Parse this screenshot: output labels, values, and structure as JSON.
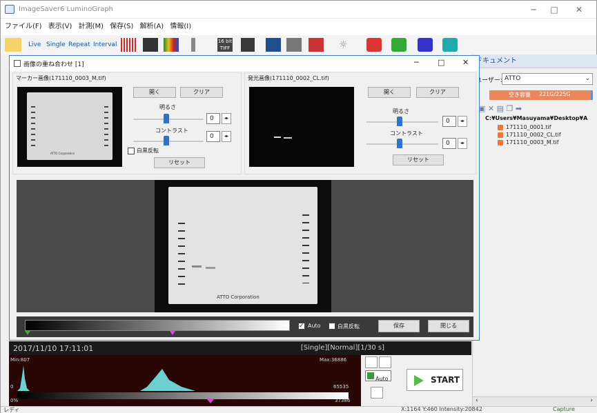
{
  "app": {
    "title": "ImageSaver6 LuminoGraph",
    "win_min": "─",
    "win_max": "□",
    "win_close": "✕"
  },
  "menu": [
    "ファイル(F)",
    "表示(V)",
    "計測(M)",
    "保存(S)",
    "解析(A)",
    "情報(I)"
  ],
  "toolbar": {
    "live": "Live",
    "single": "Single",
    "repeat": "Repeat",
    "interval": "Interval",
    "bit_label": "16 bit TIFF"
  },
  "right_panel": {
    "header": "ドキュメント",
    "user_label": "ユーザー:",
    "user_value": "ATTO",
    "capacity_label": "空き容量",
    "capacity_value": "221G/225G",
    "capacity_fraction": 0.98,
    "tree_root": "C:¥Users¥Masuyama¥Desktop¥A",
    "files": [
      "171110_0001.tif",
      "171110_0002_CL.tif",
      "171110_0003_M.tif"
    ]
  },
  "dialog": {
    "title": "画像の重ね合わせ [1]",
    "marker_label": "マーカー画像(171110_0003_M.tif)",
    "lumi_label": "発光画像(171110_0002_CL.tif)",
    "open": "開く",
    "clear": "クリア",
    "brightness": "明るさ",
    "contrast": "コントラスト",
    "reset": "リセット",
    "invert": "白黒反転",
    "spin_zero": "0",
    "auto": "Auto",
    "save": "保存",
    "close": "閉じる",
    "company": "ATTO Corporation"
  },
  "bottom": {
    "datetime": "2017/11/10 17:11:01",
    "mode": "[Single][Normal][1/30 s]",
    "min": "Min:807",
    "max": "Max:36886",
    "left_zero": "0",
    "right_high": "65535",
    "right_low": "37386",
    "corner": "0%",
    "auto": "Auto",
    "start": "START"
  },
  "status": {
    "left": "レディ",
    "coords": "X:1164  Y:460  Intensity:20842",
    "caption": "Capture"
  }
}
